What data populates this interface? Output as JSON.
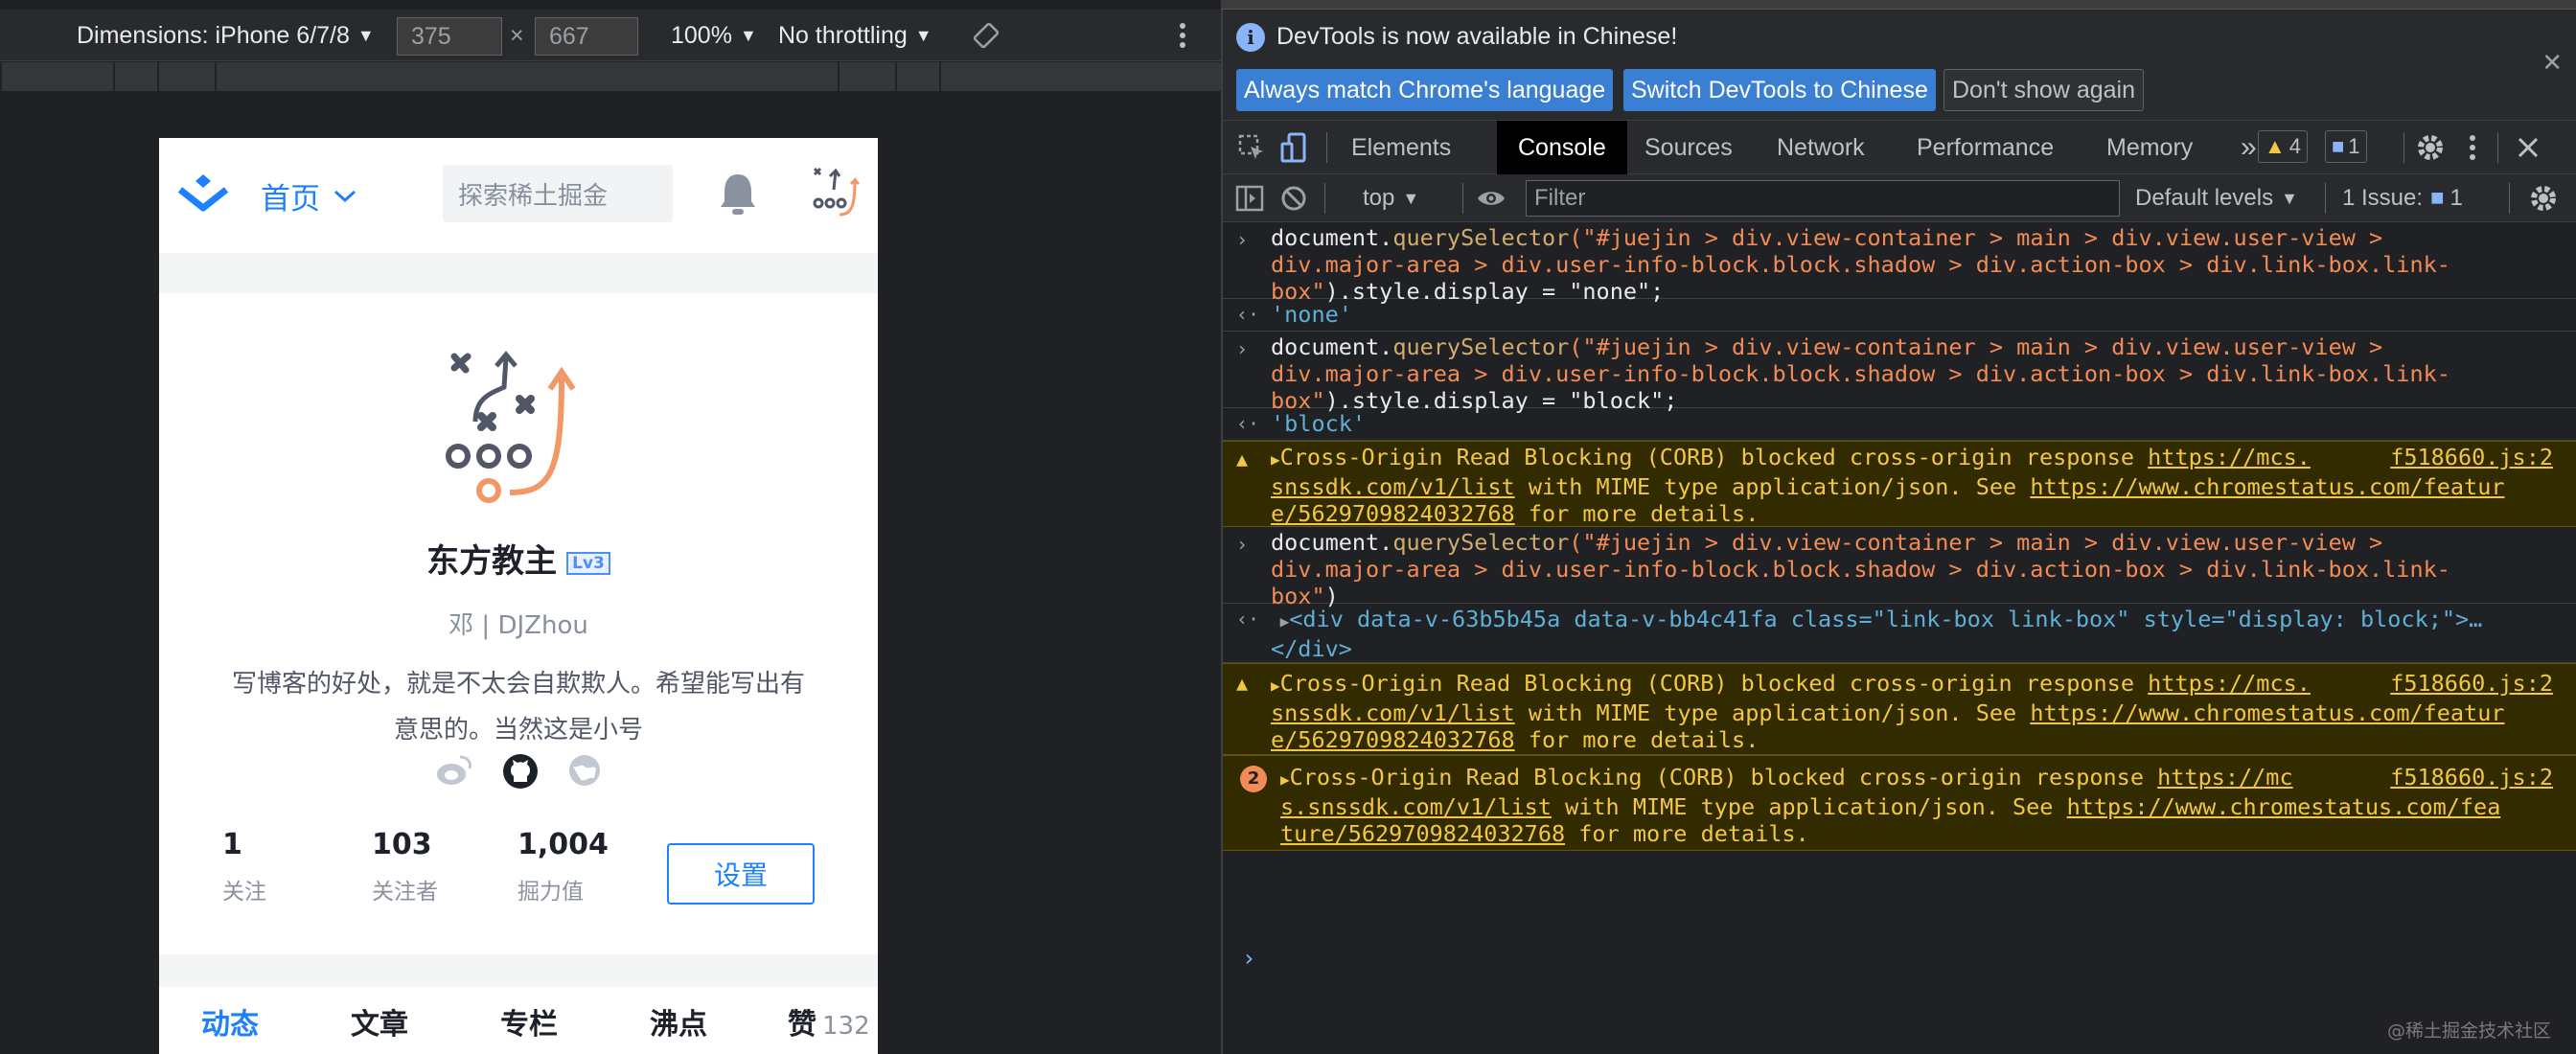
{
  "device_toolbar": {
    "dimensions_label": "Dimensions: iPhone 6/7/8",
    "width": "375",
    "times": "×",
    "height": "667",
    "zoom": "100%",
    "throttling": "No throttling"
  },
  "phone": {
    "header": {
      "home": "首页",
      "search_placeholder": "探索稀土掘金"
    },
    "profile": {
      "name": "东方教主",
      "level": "Lv3",
      "sub": "邓 | DJZhou",
      "bio_line1": "写博客的好处，就是不太会自欺欺人。希望能写出有",
      "bio_line2": "意思的。当然这是小号",
      "stats": [
        {
          "value": "1",
          "label": "关注"
        },
        {
          "value": "103",
          "label": "关注者"
        },
        {
          "value": "1,004",
          "label": "掘力值"
        }
      ],
      "settings_button": "设置"
    },
    "tabs": [
      {
        "label": "动态"
      },
      {
        "label": "文章"
      },
      {
        "label": "专栏"
      },
      {
        "label": "沸点"
      },
      {
        "label": "赞",
        "count": "132"
      }
    ]
  },
  "devtools": {
    "infobar": {
      "message": "DevTools is now available in Chinese!",
      "btn_match": "Always match Chrome's language",
      "btn_switch": "Switch DevTools to Chinese",
      "btn_dismiss": "Don't show again"
    },
    "tabs": [
      "Elements",
      "Console",
      "Sources",
      "Network",
      "Performance",
      "Memory"
    ],
    "more_tabs": "»",
    "warnings_count": "4",
    "messages_count": "1",
    "console_toolbar": {
      "context": "top",
      "filter_placeholder": "Filter",
      "levels": "Default levels",
      "issues": "1 Issue:",
      "issues_count": "1"
    },
    "console": {
      "cmd1_a": "document.",
      "cmd1_fn": "querySelector",
      "cmd1_str1": "(\"#juejin > div.view-container > main > div.view.user-view >",
      "cmd1_str2": "div.major-area > div.user-info-block.block.shadow > div.action-box > div.link-box.link-",
      "cmd1_str3": "box\"",
      "cmd1_tail": ").style.display = \"none\";",
      "res1": "'none'",
      "cmd2_tail": ").style.display = \"block\";",
      "res2": "'block'",
      "warn_line1": "Cross-Origin Read Blocking (CORB) blocked cross-origin response ",
      "warn_link1a": "https://mcs.",
      "warn_link1b": "snssdk.com/v1/list",
      "warn_mid": " with MIME type application/json. See ",
      "warn_link2a": "https://www.chromestatus.com/featur",
      "warn_link2b": "e/5629709824032768",
      "warn_end": " for more details.",
      "warn_source": "f518660.js:2",
      "cmd3_tail": ")",
      "res3_open": "<div data-v-63b5b45a data-v-bb4c41fa class=\"link-box link-box\" style=\"display: block;\">…",
      "res3_close": "</div>",
      "warn3_link1a": "https://mc",
      "warn3_link1b": "s.snssdk.com/v1/list",
      "warn3_link2a": "https://www.chromestatus.com/fea",
      "warn3_link2b": "ture/5629709824032768",
      "warn3_count": "2"
    }
  },
  "watermark": "@稀土掘金技术社区"
}
